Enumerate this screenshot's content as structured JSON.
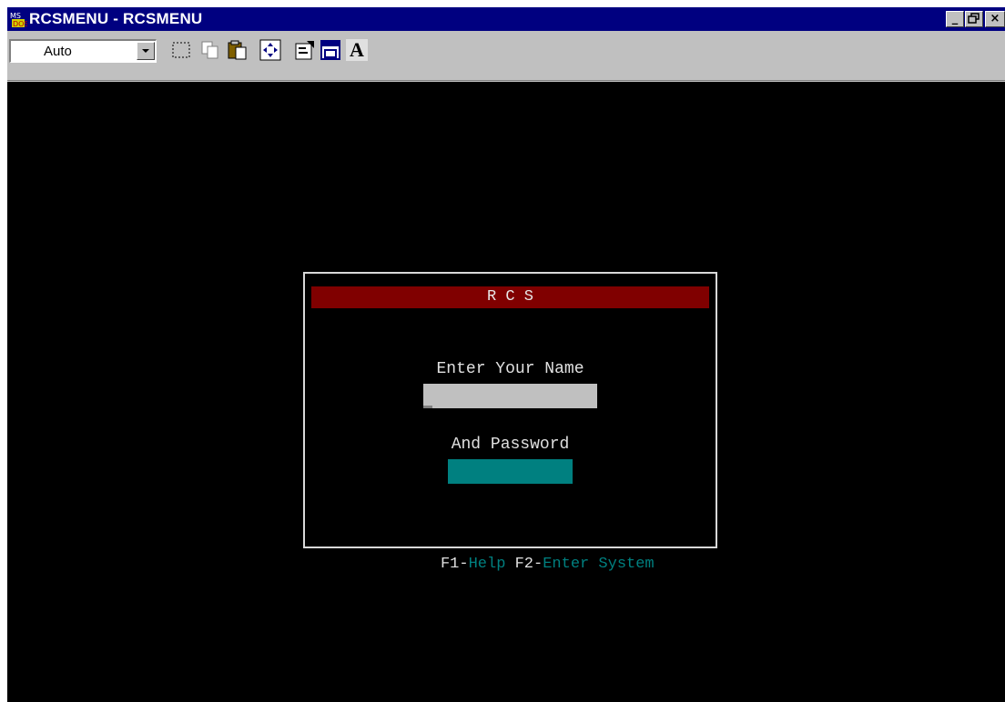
{
  "window": {
    "title": "RCSMENU - RCSMENU"
  },
  "toolbar": {
    "font_size_value": "Auto",
    "buttons": [
      "mark-icon",
      "copy-icon",
      "paste-icon",
      "fullscreen-icon",
      "properties-icon",
      "background-icon",
      "font-icon"
    ],
    "font_button_label": "A"
  },
  "dialog": {
    "title": "R C S",
    "name_prompt": "Enter Your Name",
    "password_prompt": "And Password",
    "footer": {
      "f1_key": "F1-",
      "f1_label": "Help",
      "f2_key": "F2-",
      "f2_label": "Enter System"
    }
  },
  "colors": {
    "titlebar": "#000080",
    "dialog_title_bg": "#800000",
    "name_field_bg": "#c0c0c0",
    "password_field_bg": "#008080",
    "help_text": "#008080"
  }
}
